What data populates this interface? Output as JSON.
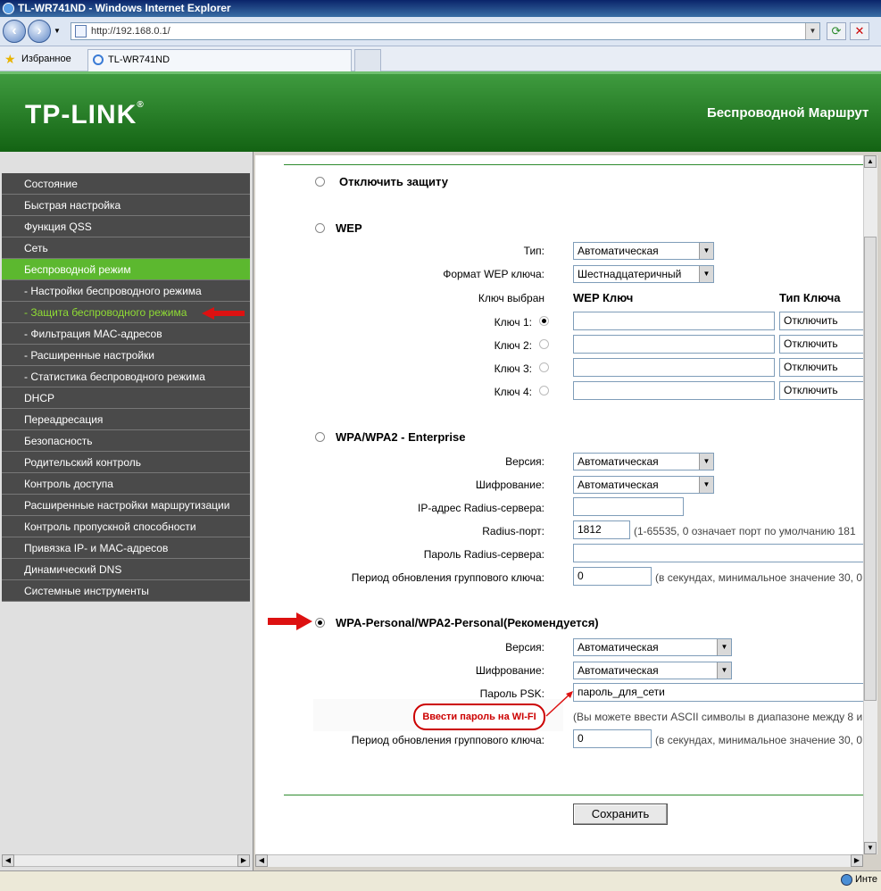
{
  "window": {
    "title": "TL-WR741ND - Windows Internet Explorer"
  },
  "browser": {
    "address": "http://192.168.0.1/",
    "favorites_label": "Избранное",
    "tab_title": "TL-WR741ND",
    "status_text": "Инте"
  },
  "header": {
    "logo": "TP-LINK",
    "title": "Беспроводной Маршрут"
  },
  "sidebar": {
    "items": [
      {
        "label": "Состояние"
      },
      {
        "label": "Быстрая настройка"
      },
      {
        "label": "Функция QSS"
      },
      {
        "label": "Сеть"
      },
      {
        "label": "Беспроводной режим"
      },
      {
        "label": "- Настройки беспроводного режима"
      },
      {
        "label": "- Защита беспроводного режима"
      },
      {
        "label": "- Фильтрация MAC-адресов"
      },
      {
        "label": "- Расширенные настройки"
      },
      {
        "label": "- Статистика беспроводного режима"
      },
      {
        "label": "DHCP"
      },
      {
        "label": "Переадресация"
      },
      {
        "label": "Безопасность"
      },
      {
        "label": "Родительский контроль"
      },
      {
        "label": "Контроль доступа"
      },
      {
        "label": "Расширенные настройки маршрутизации"
      },
      {
        "label": "Контроль пропускной способности"
      },
      {
        "label": "Привязка IP- и MAC-адресов"
      },
      {
        "label": "Динамический DNS"
      },
      {
        "label": "Системные инструменты"
      }
    ]
  },
  "main": {
    "disable": {
      "label": "Отключить защиту"
    },
    "wep": {
      "label": "WEP",
      "type_label": "Тип:",
      "type_value": "Автоматическая",
      "format_label": "Формат WEP ключа:",
      "format_value": "Шестнадцатеричный",
      "col_selected": "Ключ выбран",
      "col_key": "WEP Ключ",
      "col_type": "Тип Ключа",
      "keys": [
        {
          "label": "Ключ 1:",
          "type": "Отключить"
        },
        {
          "label": "Ключ 2:",
          "type": "Отключить"
        },
        {
          "label": "Ключ 3:",
          "type": "Отключить"
        },
        {
          "label": "Ключ 4:",
          "type": "Отключить"
        }
      ]
    },
    "enterprise": {
      "label": "WPA/WPA2 - Enterprise",
      "version_label": "Версия:",
      "version_value": "Автоматическая",
      "enc_label": "Шифрование:",
      "enc_value": "Автоматическая",
      "radius_ip_label": "IP-адрес Radius-сервера:",
      "radius_port_label": "Radius-порт:",
      "radius_port_value": "1812",
      "radius_port_hint": "(1-65535, 0 означает порт по умолчанию 181",
      "radius_pw_label": "Пароль Radius-сервера:",
      "group_label": "Период обновления группового ключа:",
      "group_value": "0",
      "group_hint": "(в секундах, минимальное значение 30, 0"
    },
    "personal": {
      "label": "WPA-Personal/WPA2-Personal(Рекомендуется)",
      "version_label": "Версия:",
      "version_value": "Автоматическая",
      "enc_label": "Шифрование:",
      "enc_value": "Автоматическая",
      "psk_label": "Пароль PSK:",
      "psk_value": "пароль_для_сети",
      "psk_hint": "(Вы можете ввести ASCII символы в диапазоне между 8 и",
      "callout": "Ввести пароль на WI-FI",
      "group_label": "Период обновления группового ключа:",
      "group_value": "0",
      "group_hint": "(в секундах, минимальное значение 30, 0"
    },
    "save_label": "Сохранить"
  },
  "colors": {
    "brand_green": "#136313",
    "menu_active": "#5cb82f",
    "annotation_red": "#dd1111"
  }
}
